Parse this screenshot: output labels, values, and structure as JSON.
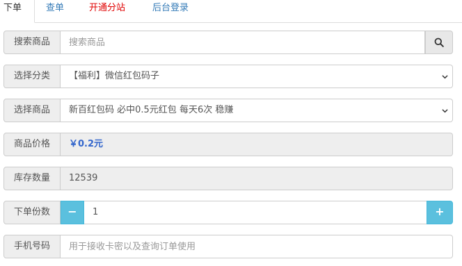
{
  "tabs": [
    {
      "label": "下单",
      "active": true
    },
    {
      "label": "查单"
    },
    {
      "label": "开通分站",
      "color": "#e00000"
    },
    {
      "label": "后台登录"
    }
  ],
  "search": {
    "label": "搜索商品",
    "placeholder": "搜索商品"
  },
  "category": {
    "label": "选择分类",
    "value": "【福利】微信红包码子"
  },
  "product": {
    "label": "选择商品",
    "value": "新百红包码 必中0.5元红包 每天6次 稳赚"
  },
  "price": {
    "label": "商品价格",
    "value": "￥0.2元"
  },
  "stock": {
    "label": "库存数量",
    "value": "12539"
  },
  "quantity": {
    "label": "下单份数",
    "value": "1",
    "minus": "−",
    "plus": "+"
  },
  "phone": {
    "label": "手机号码",
    "placeholder": "用于接收卡密以及查询订单使用"
  },
  "colors": {
    "accent": "#5bc0de",
    "link": "#337ab7",
    "highlight": "#e00000",
    "price": "#3366cc"
  }
}
